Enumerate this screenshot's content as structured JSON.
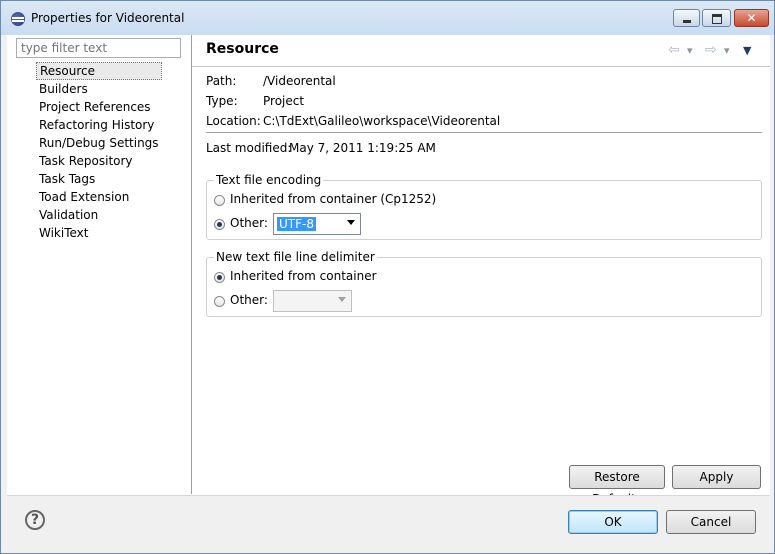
{
  "window": {
    "title": "Properties for Videorental",
    "controls": {
      "minimize": "minimize-icon",
      "maximize": "maximize-icon",
      "close": "close-icon",
      "close_glyph": "✕"
    }
  },
  "sidebar": {
    "filter_placeholder": "type filter text",
    "items": [
      {
        "label": "Resource",
        "selected": true
      },
      {
        "label": "Builders"
      },
      {
        "label": "Project References"
      },
      {
        "label": "Refactoring History"
      },
      {
        "label": "Run/Debug Settings"
      },
      {
        "label": "Task Repository"
      },
      {
        "label": "Task Tags"
      },
      {
        "label": "Toad Extension"
      },
      {
        "label": "Validation"
      },
      {
        "label": "WikiText"
      }
    ]
  },
  "page": {
    "title": "Resource",
    "nav": {
      "back": "⇦",
      "back_menu": "▾",
      "forward": "⇨",
      "forward_menu": "▾",
      "view_menu": "▼"
    },
    "properties": {
      "path_label": "Path:",
      "path_value": "/Videorental",
      "type_label": "Type:",
      "type_value": "Project",
      "location_label": "Location:",
      "location_value": "C:\\TdExt\\Galileo\\workspace\\Videorental",
      "modified_label": "Last modified:",
      "modified_value": "May 7, 2011 1:19:25 AM"
    },
    "encoding": {
      "legend": "Text file encoding",
      "inherited_label": "Inherited from container (Cp1252)",
      "other_label": "Other:",
      "selected_option": "other",
      "other_value": "UTF-8"
    },
    "delimiter": {
      "legend": "New text file line delimiter",
      "inherited_label": "Inherited from container",
      "other_label": "Other:",
      "selected_option": "inherited",
      "other_value": ""
    },
    "buttons": {
      "restore_defaults": "Restore Defaults",
      "apply": "Apply"
    }
  },
  "footer": {
    "help_icon": "help-icon",
    "help_glyph": "?",
    "ok": "OK",
    "cancel": "Cancel"
  },
  "colors": {
    "selection": "#3399ff",
    "title_bar": "#c9dcf0",
    "close_button": "#c7492e"
  }
}
